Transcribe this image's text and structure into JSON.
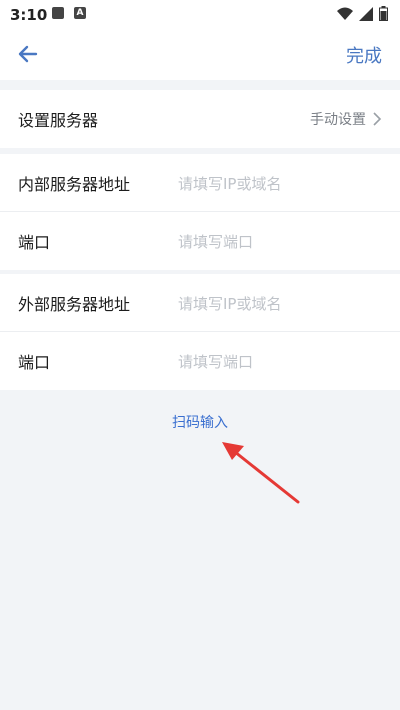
{
  "statusbar": {
    "time": "3:10",
    "icons": [
      "image-icon",
      "a-icon",
      "wifi-icon",
      "signal-icon",
      "battery-icon"
    ],
    "a_letter": "A"
  },
  "header": {
    "back_icon": "back-arrow-icon",
    "done_label": "完成"
  },
  "server_settings": {
    "label": "设置服务器",
    "mode_value": "手动设置"
  },
  "internal": {
    "address_label": "内部服务器地址",
    "address_placeholder": "请填写IP或域名",
    "port_label": "端口",
    "port_placeholder": "请填写端口"
  },
  "external": {
    "address_label": "外部服务器地址",
    "address_placeholder": "请填写IP或域名",
    "port_label": "端口",
    "port_placeholder": "请填写端口"
  },
  "scan_input_label": "扫码输入",
  "colors": {
    "accent": "#4a78c2",
    "link": "#3a6fd0",
    "annotation_arrow": "#e53935",
    "background": "#f2f4f7"
  }
}
